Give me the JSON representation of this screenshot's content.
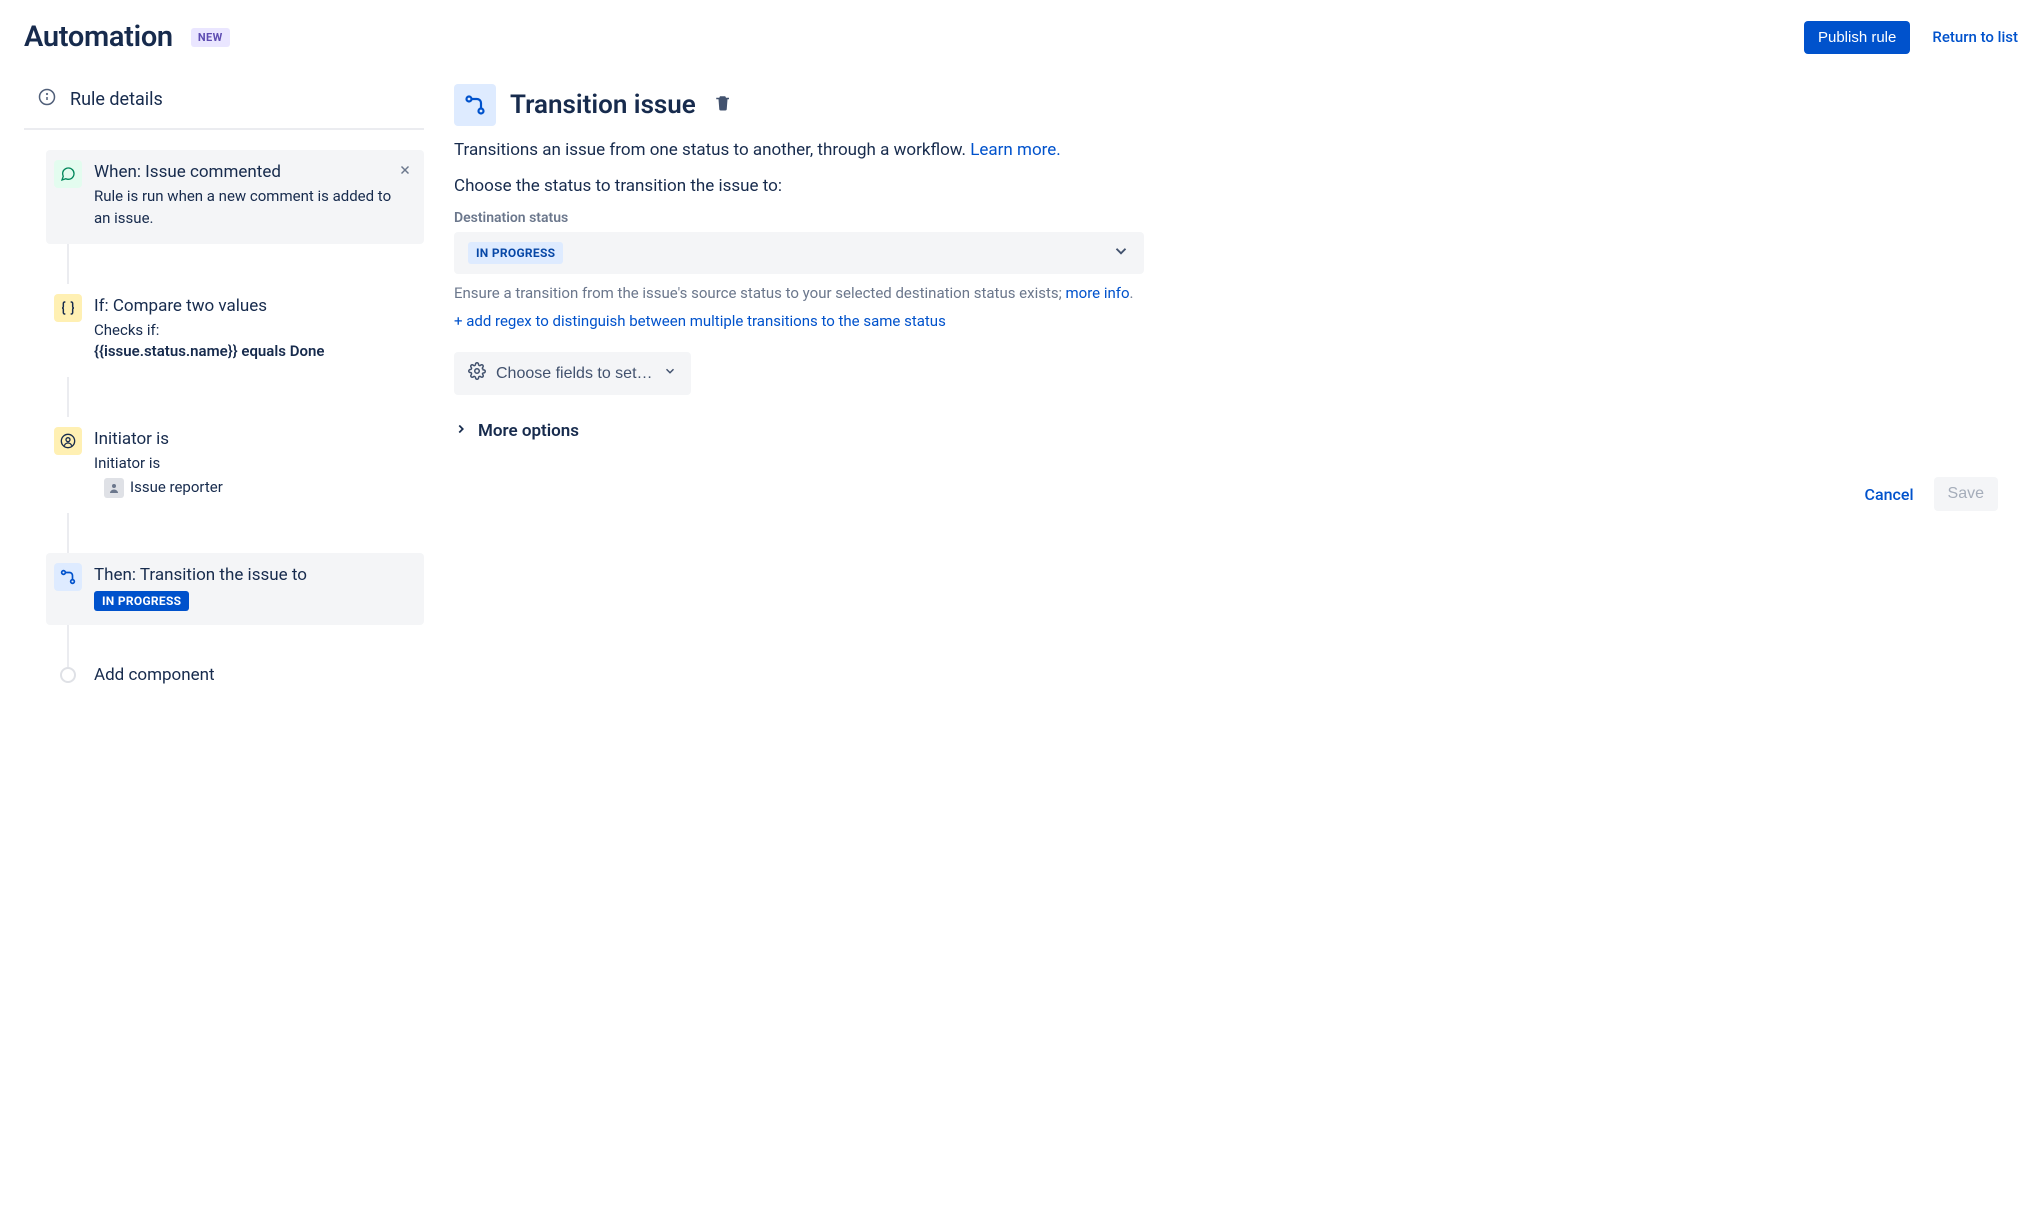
{
  "header": {
    "title": "Automation",
    "badge": "NEW",
    "publish": "Publish rule",
    "return": "Return to list"
  },
  "sidebar": {
    "rule_details": "Rule details",
    "steps": [
      {
        "title": "When: Issue commented",
        "desc": "Rule is run when a new comment is added to an issue."
      },
      {
        "title": "If: Compare two values",
        "desc_prefix": "Checks if:",
        "desc_bold": "{{issue.status.name}} equals Done"
      },
      {
        "title": "Initiator is",
        "desc_prefix": "Initiator is",
        "reporter": "Issue reporter"
      },
      {
        "title": "Then: Transition the issue to",
        "status": "IN PROGRESS"
      }
    ],
    "add": "Add component"
  },
  "main": {
    "title": "Transition issue",
    "desc": "Transitions an issue from one status to another, through a workflow. ",
    "learn_more": "Learn more.",
    "choose_label": "Choose the status to transition the issue to:",
    "dest_label": "Destination status",
    "dest_value": "IN PROGRESS",
    "ensure_text": "Ensure a transition from the issue's source status to your selected destination status exists; ",
    "more_info": "more info",
    "regex_link": "+ add regex to distinguish between multiple transitions to the same status",
    "fields_btn": "Choose fields to set…",
    "more_options": "More options",
    "cancel": "Cancel",
    "save": "Save"
  }
}
